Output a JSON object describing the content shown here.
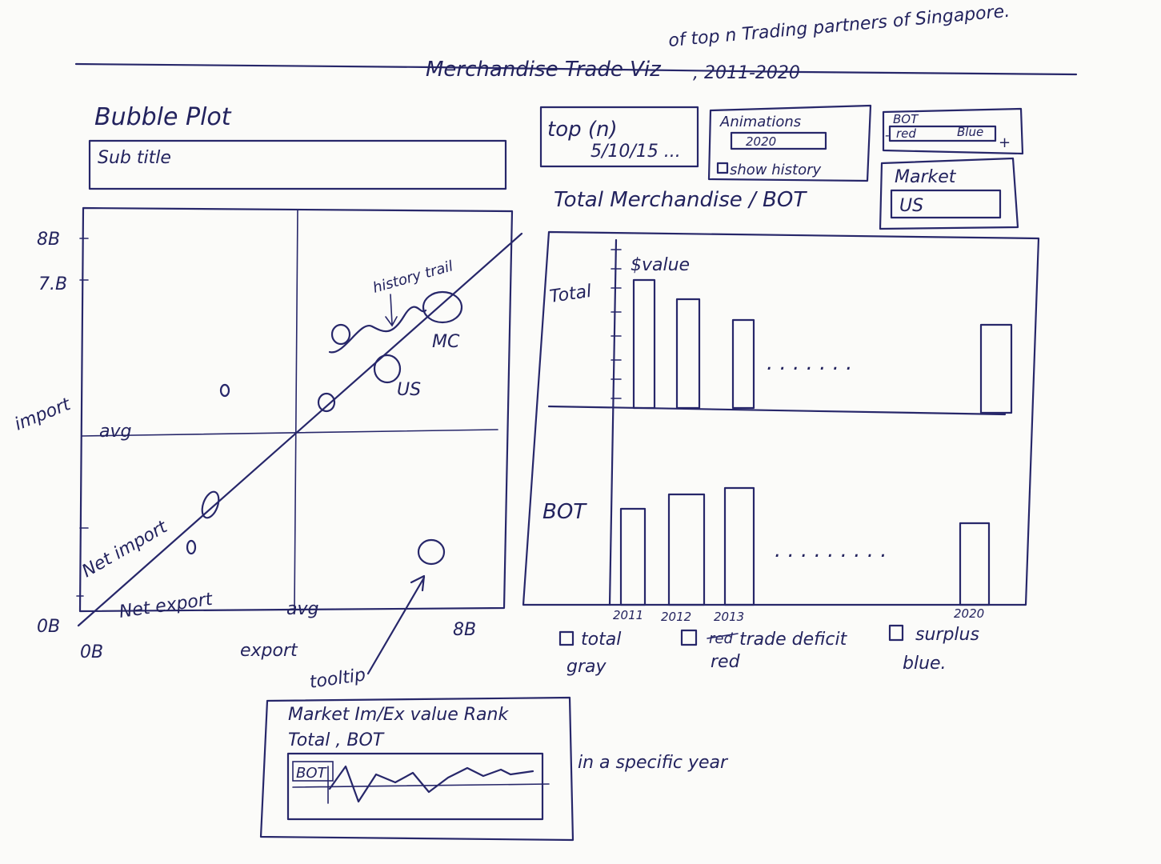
{
  "header": {
    "main_title": "Merchandise Trade Viz",
    "superscript": "of top n Trading partners of Singapore.",
    "years": ", 2011-2020"
  },
  "bubble_panel": {
    "title": "Bubble Plot",
    "subtitle": "Sub title",
    "y_ticks": [
      "8B",
      "7.B",
      "0B"
    ],
    "x_ticks": [
      "0B",
      "8B"
    ],
    "y_label": "import",
    "x_label": "export",
    "avg_h": "avg",
    "avg_v": "avg",
    "net_import": "Net import",
    "net_export": "Net export",
    "history_trail": "history trail",
    "label_mc": "MC",
    "label_us": "US",
    "tooltip_arrow_label": "tooltip"
  },
  "tooltip_box": {
    "line1": "Market Im/Ex value Rank",
    "line2": "Total , BOT",
    "mini_label": "BOT",
    "note": "in a specific year"
  },
  "controls": {
    "topn_label": "top (n)",
    "topn_options": "5/10/15 ...",
    "animations_label": "Animations",
    "year_value": "2020",
    "show_history_label": "show history",
    "bot_label": "BOT",
    "bot_red": "red",
    "bot_blue": "Blue",
    "bot_minus": "-",
    "bot_plus": "+",
    "market_label": "Market",
    "market_value": "US"
  },
  "bar_panel": {
    "title": "Total Merchandise / BOT",
    "value_label": "$value",
    "total_label": "Total",
    "bot_label": "BOT",
    "years": [
      "2011",
      "2012",
      "2013",
      "2020"
    ],
    "dots_top": ". . . . . . .",
    "dots_bottom": ". . . . . . . . ."
  },
  "legend": {
    "total": "total",
    "total_color": "gray",
    "deficit_strike": "red",
    "deficit": "trade deficit",
    "deficit_color": "red",
    "surplus": "surplus",
    "surplus_color": "blue."
  }
}
